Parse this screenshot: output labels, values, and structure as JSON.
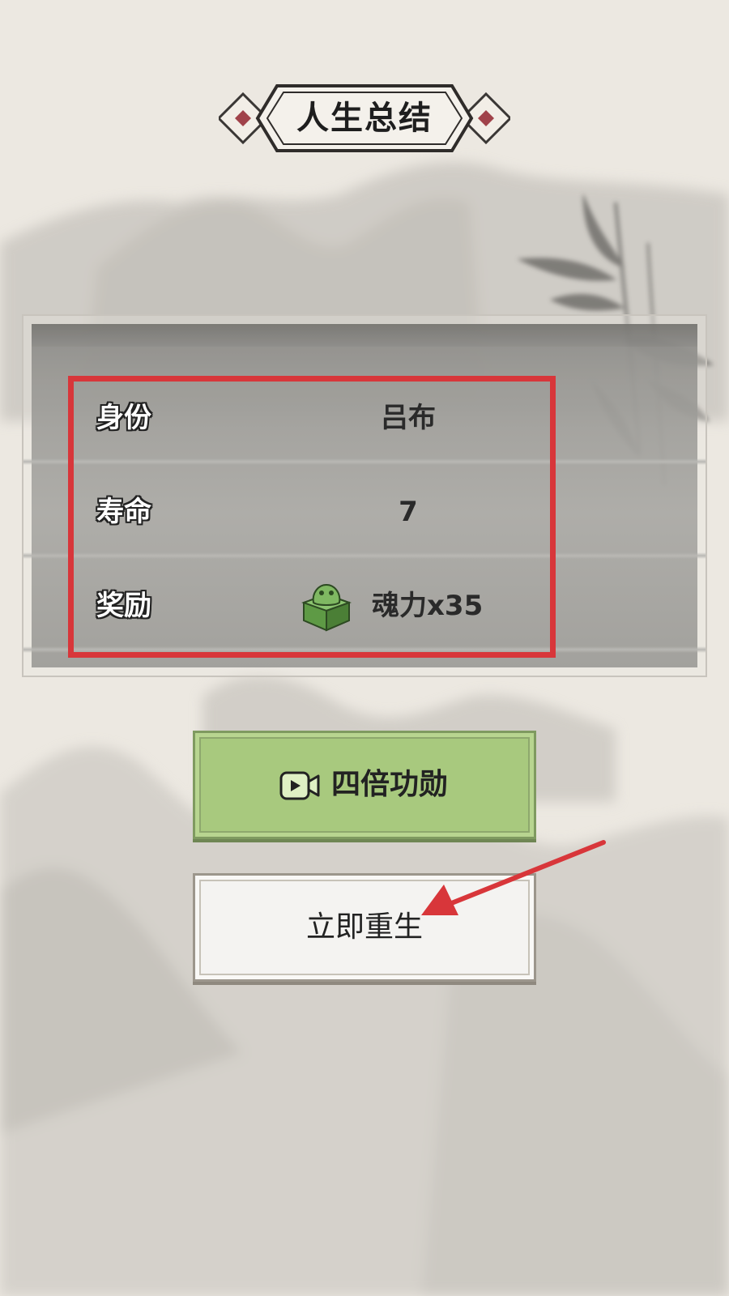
{
  "title": "人生总结",
  "summary": {
    "rows": [
      {
        "label": "身份",
        "value": "吕布"
      },
      {
        "label": "寿命",
        "value": "7"
      },
      {
        "label": "奖励",
        "value": "魂力x35",
        "icon": "jade-seal-icon"
      }
    ]
  },
  "buttons": {
    "quadruple_merit": {
      "label": "四倍功勋",
      "icon": "video-icon"
    },
    "rebirth_now": {
      "label": "立即重生"
    }
  },
  "annotations": {
    "highlight_color": "#d8363a",
    "arrow_color": "#d8363a"
  },
  "colors": {
    "background": "#ece8e1",
    "primary_button": "#a8c97e",
    "secondary_button": "#f4f3f1"
  }
}
